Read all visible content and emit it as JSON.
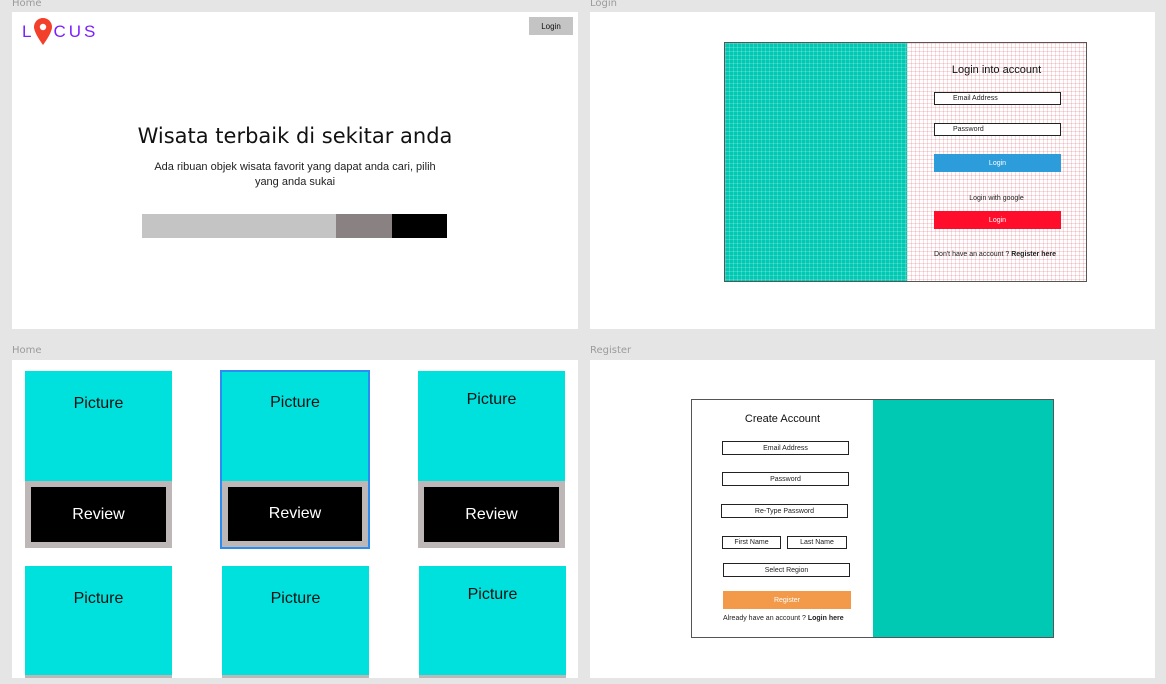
{
  "frames": {
    "home1": {
      "label": "Home"
    },
    "login": {
      "label": "Login"
    },
    "home2": {
      "label": "Home"
    },
    "register": {
      "label": "Register"
    }
  },
  "home": {
    "logo": {
      "l": "L",
      "rest": "CUS",
      "pin_icon": "map-pin-icon",
      "color": "#7a1fff",
      "pin_color": "#f2402a"
    },
    "login_button": "Login",
    "headline": "Wisata terbaik di sekitar anda",
    "subline1": "Ada ribuan objek wisata favorit yang dapat anda cari, pilih",
    "subline2": "yang anda sukai"
  },
  "login": {
    "title": "Login into account",
    "email_placeholder": "Email Address",
    "password_placeholder": "Password",
    "login_button": "Login",
    "google_label": "Login with google",
    "google_button": "Login",
    "no_account": "Don't have an account ?",
    "register_link": "Register here",
    "colors": {
      "blue": "#2d9cdb",
      "red": "#ff0d2a",
      "teal": "#00c9b3"
    }
  },
  "gallery": {
    "cards": [
      {
        "picture": "Picture",
        "review": "Review"
      },
      {
        "picture": "Picture",
        "review": "Review"
      },
      {
        "picture": "Picture",
        "review": "Review"
      },
      {
        "picture": "Picture"
      },
      {
        "picture": "Picture"
      },
      {
        "picture": "Picture"
      }
    ],
    "colors": {
      "picture": "#00e1dd",
      "review_frame": "#bdb7b7",
      "selected": "#2d8cf0"
    }
  },
  "register": {
    "title": "Create Account",
    "email": "Email Address",
    "password": "Password",
    "retype": "Re-Type Password",
    "first_name": "First Name",
    "last_name": "Last Name",
    "region": "Select Region",
    "register_button": "Register",
    "have_account": "Already have an account ?",
    "login_link": "Login here",
    "colors": {
      "orange": "#f2994a",
      "teal": "#00c9b3"
    }
  }
}
